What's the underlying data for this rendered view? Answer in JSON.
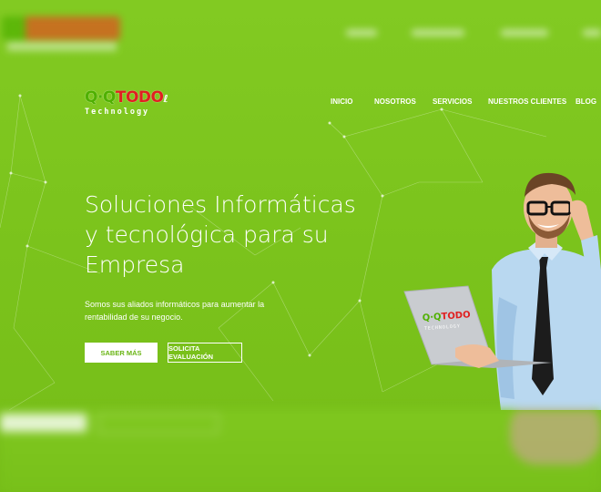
{
  "logo": {
    "part1": "Q·Q",
    "part2": "TODO",
    "subtitle": "Technology"
  },
  "nav": {
    "items": [
      {
        "label": "INICIO"
      },
      {
        "label": "NOSOTROS"
      },
      {
        "label": "SERVICIOS"
      },
      {
        "label": "NUESTROS CLIENTES"
      },
      {
        "label": "BLOG"
      }
    ]
  },
  "hero": {
    "title_line1": "Soluciones Informáticas",
    "title_line2": "y tecnológica para su",
    "title_line3": "Empresa",
    "subtitle": "Somos sus aliados informáticos para aumentar la rentabilidad de su negocio.",
    "primary_button": "SABER MÁS",
    "secondary_button": "SOLICITA EVALUACIÓN"
  },
  "laptop_logo": {
    "part1": "Q·Q",
    "part2": "TODO",
    "subtitle": "TECHNOLOGY"
  },
  "colors": {
    "background": "#7cc41f",
    "button_text": "#6ab515",
    "logo_green": "#4fb000",
    "logo_red": "#e02020"
  }
}
